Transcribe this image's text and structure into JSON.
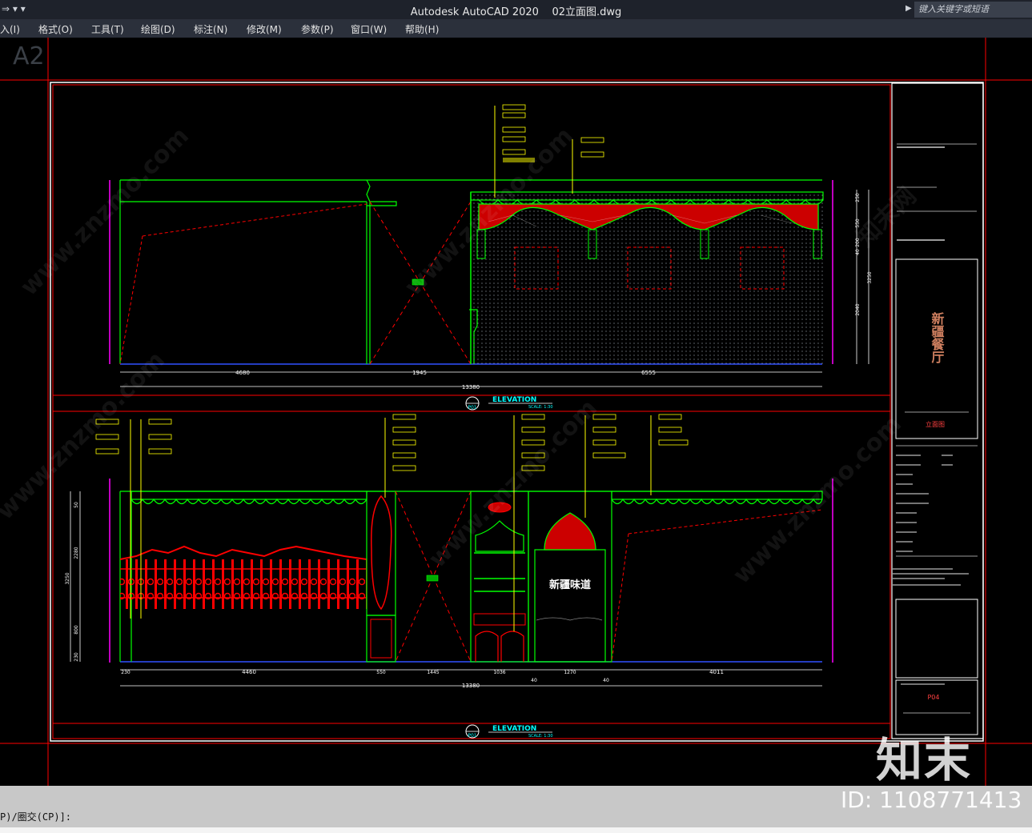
{
  "app": {
    "title": "Autodesk AutoCAD 2020",
    "filename": "02立面图.dwg",
    "search_placeholder": "键入关键字或短语",
    "quick_access": "⇒ ▾  ▾"
  },
  "menu": [
    {
      "label": "入(I)"
    },
    {
      "label": "格式(O)"
    },
    {
      "label": "工具(T)"
    },
    {
      "label": "绘图(D)"
    },
    {
      "label": "标注(N)"
    },
    {
      "label": "修改(M)"
    },
    {
      "label": "参数(P)"
    },
    {
      "label": "窗口(W)"
    },
    {
      "label": "帮助(H)"
    }
  ],
  "drawing": {
    "sheet_size": "A2",
    "elevation_upper": {
      "dimensions": [
        "4680",
        "1945",
        "6555"
      ],
      "total": "13380",
      "vertical_dims": [
        "250",
        "550",
        "200",
        "40",
        "2040",
        "3250"
      ],
      "title": "ELEVATION",
      "scale": "SCALE: 1:30",
      "ref": "P01"
    },
    "elevation_lower": {
      "dimensions": [
        "230",
        "4460",
        "550",
        "1445",
        "1036",
        "40",
        "1270",
        "40",
        "4011"
      ],
      "total": "13380",
      "vertical_dims": [
        "50",
        "2280",
        "3250",
        "800",
        "230"
      ],
      "title": "ELEVATION",
      "scale": "SCALE: 1:30",
      "ref": "P01",
      "sign_text": "新疆味道"
    },
    "title_block": {
      "project_name": "新疆餐厅",
      "drawing_label": "立面图",
      "sheet_code": "P04"
    }
  },
  "command_line": {
    "text": "P)/圈交(CP)]:"
  },
  "watermark": {
    "logo": "知末",
    "id": "ID: 1108771413",
    "site": "www.znzmo.com",
    "site_cn": "知末网"
  },
  "colors": {
    "titlebar_bg": "#1e222b",
    "menubar_bg": "#2b303b",
    "canvas_bg": "#000000",
    "cad_green": "#00ff00",
    "cad_red": "#ff0000",
    "cad_yellow": "#ffff00",
    "cad_cyan": "#00ffff",
    "cad_magenta": "#ff00ff",
    "cad_white": "#ffffff",
    "cmdline_bg": "#c8c8c8"
  }
}
